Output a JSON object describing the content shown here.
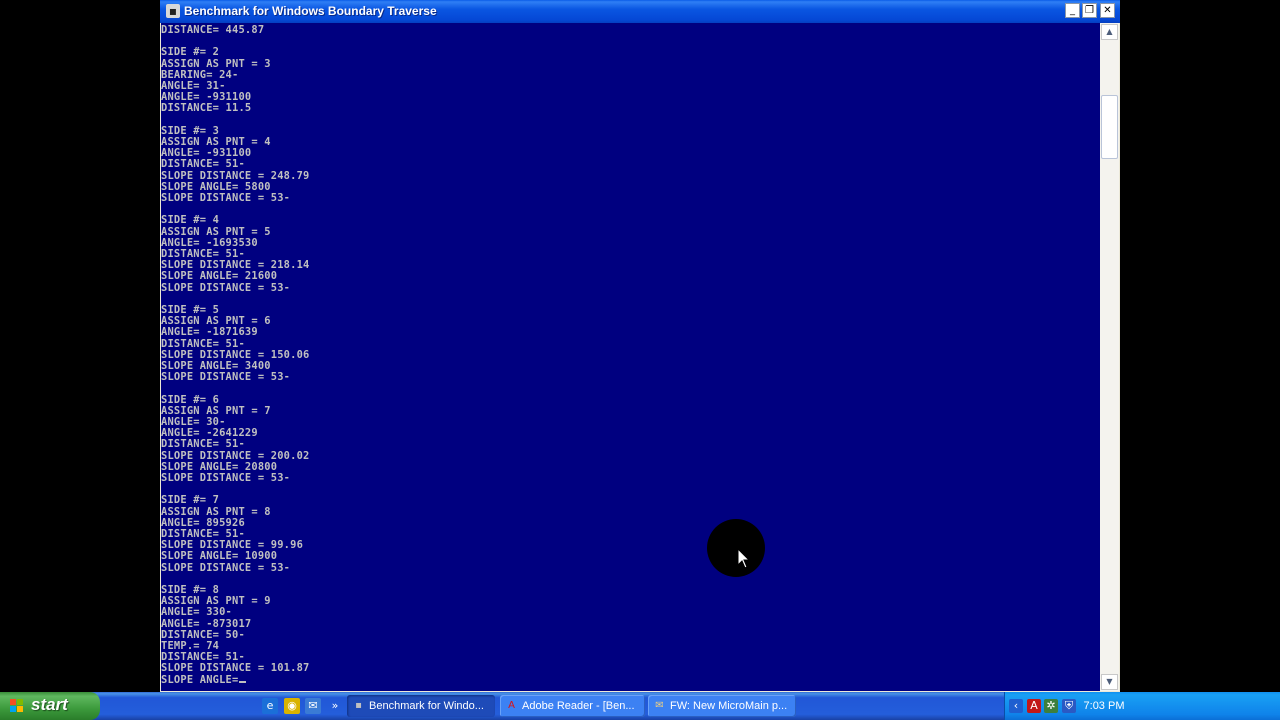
{
  "window": {
    "title": "Benchmark for Windows Boundary Traverse",
    "minimize_glyph": "_",
    "maximize_glyph": "❐",
    "close_glyph": "✕"
  },
  "console": {
    "lines": [
      "DISTANCE= 445.87",
      "",
      "SIDE #= 2",
      "ASSIGN AS PNT = 3",
      "BEARING= 24-",
      "ANGLE= 31-",
      "ANGLE= -931100",
      "DISTANCE= 11.5",
      "",
      "SIDE #= 3",
      "ASSIGN AS PNT = 4",
      "ANGLE= -931100",
      "DISTANCE= 51-",
      "SLOPE DISTANCE = 248.79",
      "SLOPE ANGLE= 5800",
      "SLOPE DISTANCE = 53-",
      "",
      "SIDE #= 4",
      "ASSIGN AS PNT = 5",
      "ANGLE= -1693530",
      "DISTANCE= 51-",
      "SLOPE DISTANCE = 218.14",
      "SLOPE ANGLE= 21600",
      "SLOPE DISTANCE = 53-",
      "",
      "SIDE #= 5",
      "ASSIGN AS PNT = 6",
      "ANGLE= -1871639",
      "DISTANCE= 51-",
      "SLOPE DISTANCE = 150.06",
      "SLOPE ANGLE= 3400",
      "SLOPE DISTANCE = 53-",
      "",
      "SIDE #= 6",
      "ASSIGN AS PNT = 7",
      "ANGLE= 30-",
      "ANGLE= -2641229",
      "DISTANCE= 51-",
      "SLOPE DISTANCE = 200.02",
      "SLOPE ANGLE= 20800",
      "SLOPE DISTANCE = 53-",
      "",
      "SIDE #= 7",
      "ASSIGN AS PNT = 8",
      "ANGLE= 895926",
      "DISTANCE= 51-",
      "SLOPE DISTANCE = 99.96",
      "SLOPE ANGLE= 10900",
      "SLOPE DISTANCE = 53-",
      "",
      "SIDE #= 8",
      "ASSIGN AS PNT = 9",
      "ANGLE= 330-",
      "ANGLE= -873017",
      "DISTANCE= 50-",
      "TEMP.= 74",
      "DISTANCE= 51-",
      "SLOPE DISTANCE = 101.87",
      "SLOPE ANGLE="
    ]
  },
  "scrollbar": {
    "up_glyph": "▲",
    "down_glyph": "▼"
  },
  "taskbar": {
    "start_label": "start",
    "quick_launch": [
      {
        "name": "ie-icon",
        "glyph": "e",
        "color": "#1b6fd8"
      },
      {
        "name": "media-icon",
        "glyph": "◉",
        "color": "#d9b300"
      },
      {
        "name": "outlook-icon",
        "glyph": "✉",
        "color": "#3a7bd5"
      },
      {
        "name": "quick-launch-expand-icon",
        "glyph": "»",
        "color": ""
      }
    ],
    "tasks": [
      {
        "label": "Benchmark for Windo...",
        "icon": "▪",
        "icon_color": "#c0c0c0",
        "active": true
      },
      {
        "label": "Adobe Reader - [Ben...",
        "icon": "A",
        "icon_color": "#d11",
        "active": false
      },
      {
        "label": "FW: New MicroMain p...",
        "icon": "✉",
        "icon_color": "#f0d080",
        "active": false
      }
    ],
    "tray_icons": [
      {
        "name": "tray-arrow-icon",
        "glyph": "‹",
        "color": "#1e5fd0"
      },
      {
        "name": "tray-adobe-icon",
        "glyph": "A",
        "color": "#c21818"
      },
      {
        "name": "tray-network-icon",
        "glyph": "✲",
        "color": "#3d7f3d"
      },
      {
        "name": "tray-security-icon",
        "glyph": "⛨",
        "color": "#2a59c4"
      }
    ],
    "clock": "7:03 PM"
  }
}
